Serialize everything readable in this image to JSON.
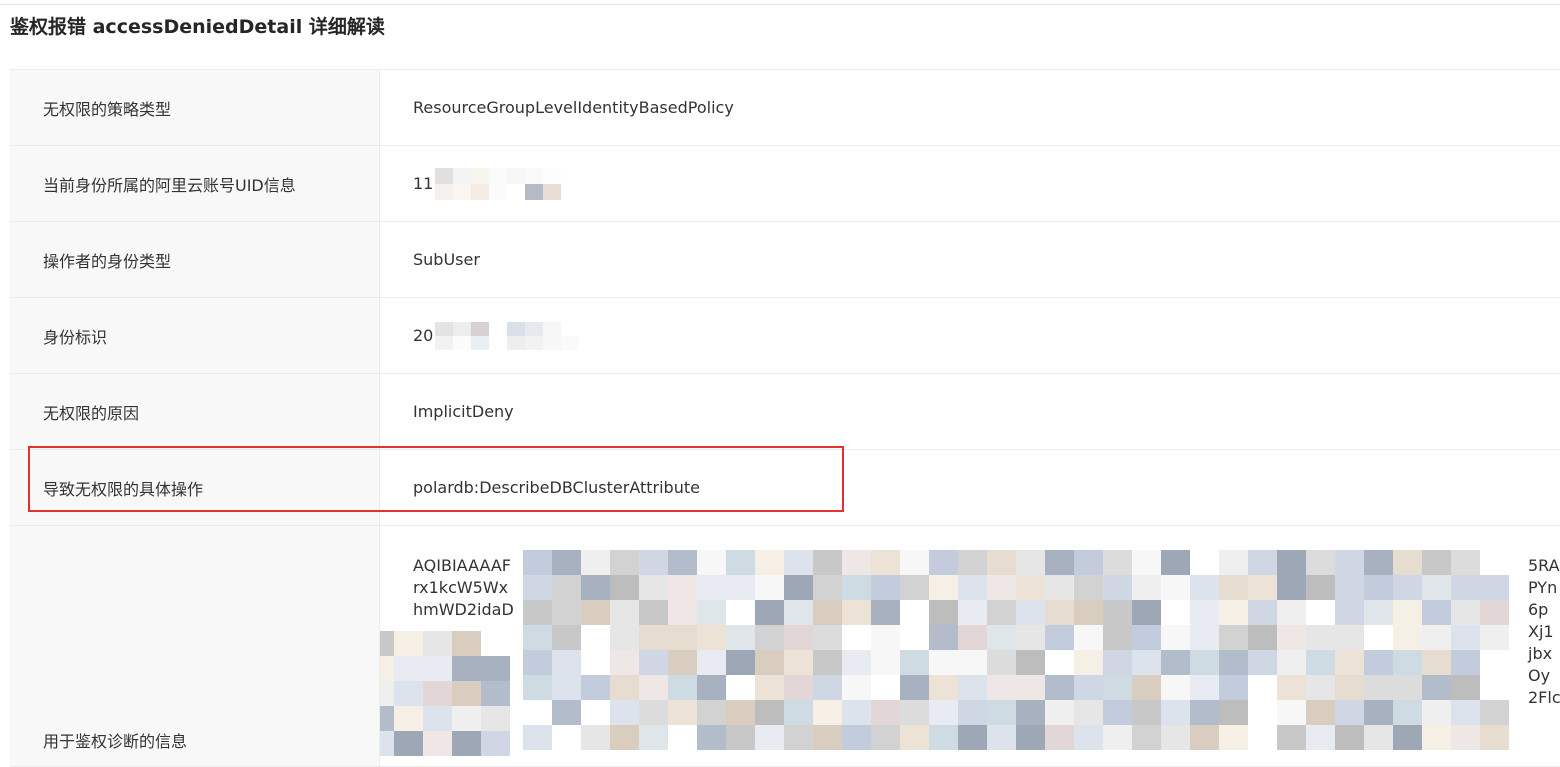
{
  "page": {
    "title": "鉴权报错 accessDeniedDetail 详细解读"
  },
  "rows": [
    {
      "label": "无权限的策略类型",
      "value": "ResourceGroupLevelIdentityBasedPolicy"
    },
    {
      "label": "当前身份所属的阿里云账号UID信息",
      "value": "11"
    },
    {
      "label": "操作者的身份类型",
      "value": "SubUser"
    },
    {
      "label": "身份标识",
      "value": "20"
    },
    {
      "label": "无权限的原因",
      "value": "ImplicitDeny"
    },
    {
      "label": "导致无权限的具体操作",
      "value": "polardb:DescribeDBClusterAttribute"
    }
  ],
  "diagnostic": {
    "label": "用于鉴权诊断的信息",
    "visible_line_starts": [
      "AQIBIAAAAF",
      "rx1kcW5Wx",
      "hmWD2idaD"
    ],
    "visible_line_ends": [
      "5RA",
      "PYn",
      "6p",
      "Xj1",
      "jbx",
      "Oy",
      "2Flc"
    ]
  },
  "colors": {
    "highlight_border": "#e3312d",
    "label_bg": "#f8f8f8",
    "border": "#ececec"
  }
}
